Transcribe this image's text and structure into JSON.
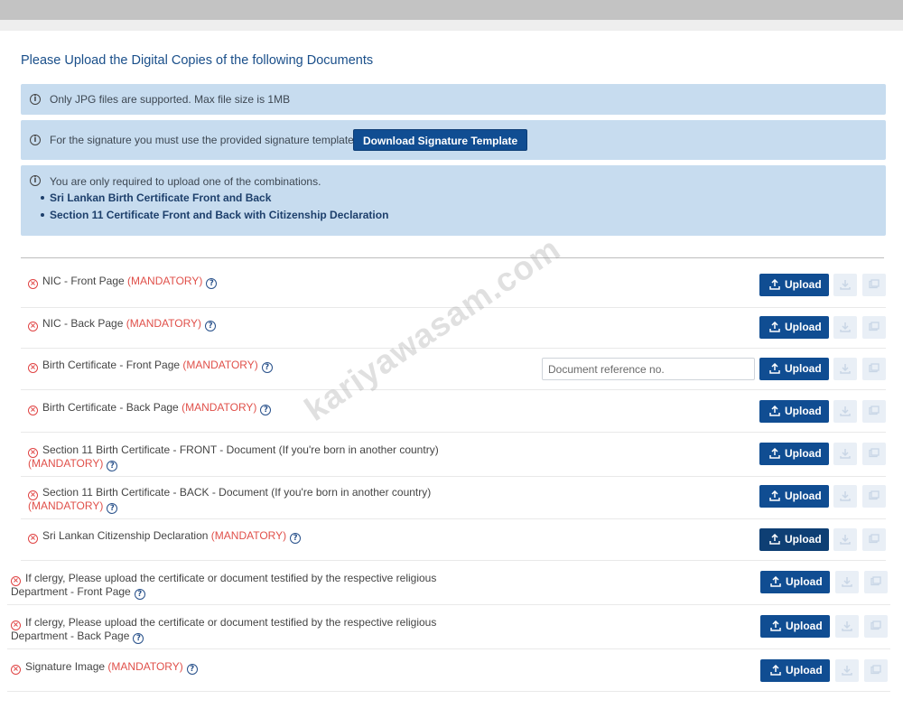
{
  "heading": "Please Upload the Digital Copies of the following Documents",
  "alerts": {
    "file_info": "Only JPG files are supported. Max file size is 1MB",
    "signature_info": "For the signature you must use the provided signature template.",
    "signature_button": "Download Signature Template",
    "combination_info": "You are only required to upload one of the combinations.",
    "combinations": [
      "Sri Lankan Birth Certificate Front and Back",
      "Section 11 Certificate Front and Back with Citizenship Declaration"
    ]
  },
  "reference_placeholder": "Document reference no.",
  "upload_label": "Upload",
  "documents": [
    {
      "line1": "NIC - Front Page",
      "mandatory": "(MANDATORY)"
    },
    {
      "line1": "NIC - Back Page",
      "mandatory": "(MANDATORY)"
    },
    {
      "line1": "Birth Certificate - Front Page",
      "mandatory": "(MANDATORY)"
    },
    {
      "line1": "Birth Certificate - Back Page",
      "mandatory": "(MANDATORY)"
    },
    {
      "line1": "Section 11 Birth Certificate - FRONT - Document (If you're born in another country)",
      "mandatory": "(MANDATORY)"
    },
    {
      "line1": "Section 11 Birth Certificate - BACK - Document (If you're born in another country)",
      "mandatory": "(MANDATORY)"
    },
    {
      "line1": "Sri Lankan Citizenship Declaration",
      "mandatory": "(MANDATORY)"
    },
    {
      "line1": "If clergy, Please upload the certificate or document testified by the respective religious",
      "line2": "Department - Front Page"
    },
    {
      "line1": "If clergy, Please upload the certificate or document testified by the respective religious",
      "line2": "Department - Back Page"
    },
    {
      "line1": "Signature Image",
      "mandatory": "(MANDATORY)"
    }
  ],
  "watermark": "kariyawasam.com",
  "icons": {
    "info": "info-icon",
    "status": "error-x-icon",
    "help": "question-icon",
    "upload": "upload-icon",
    "download": "download-icon",
    "preview": "image-preview-icon"
  },
  "colors": {
    "primary": "#104d92",
    "alert_bg": "#c7dcef",
    "mandatory": "#e0504a",
    "heading": "#1a4f8a"
  }
}
